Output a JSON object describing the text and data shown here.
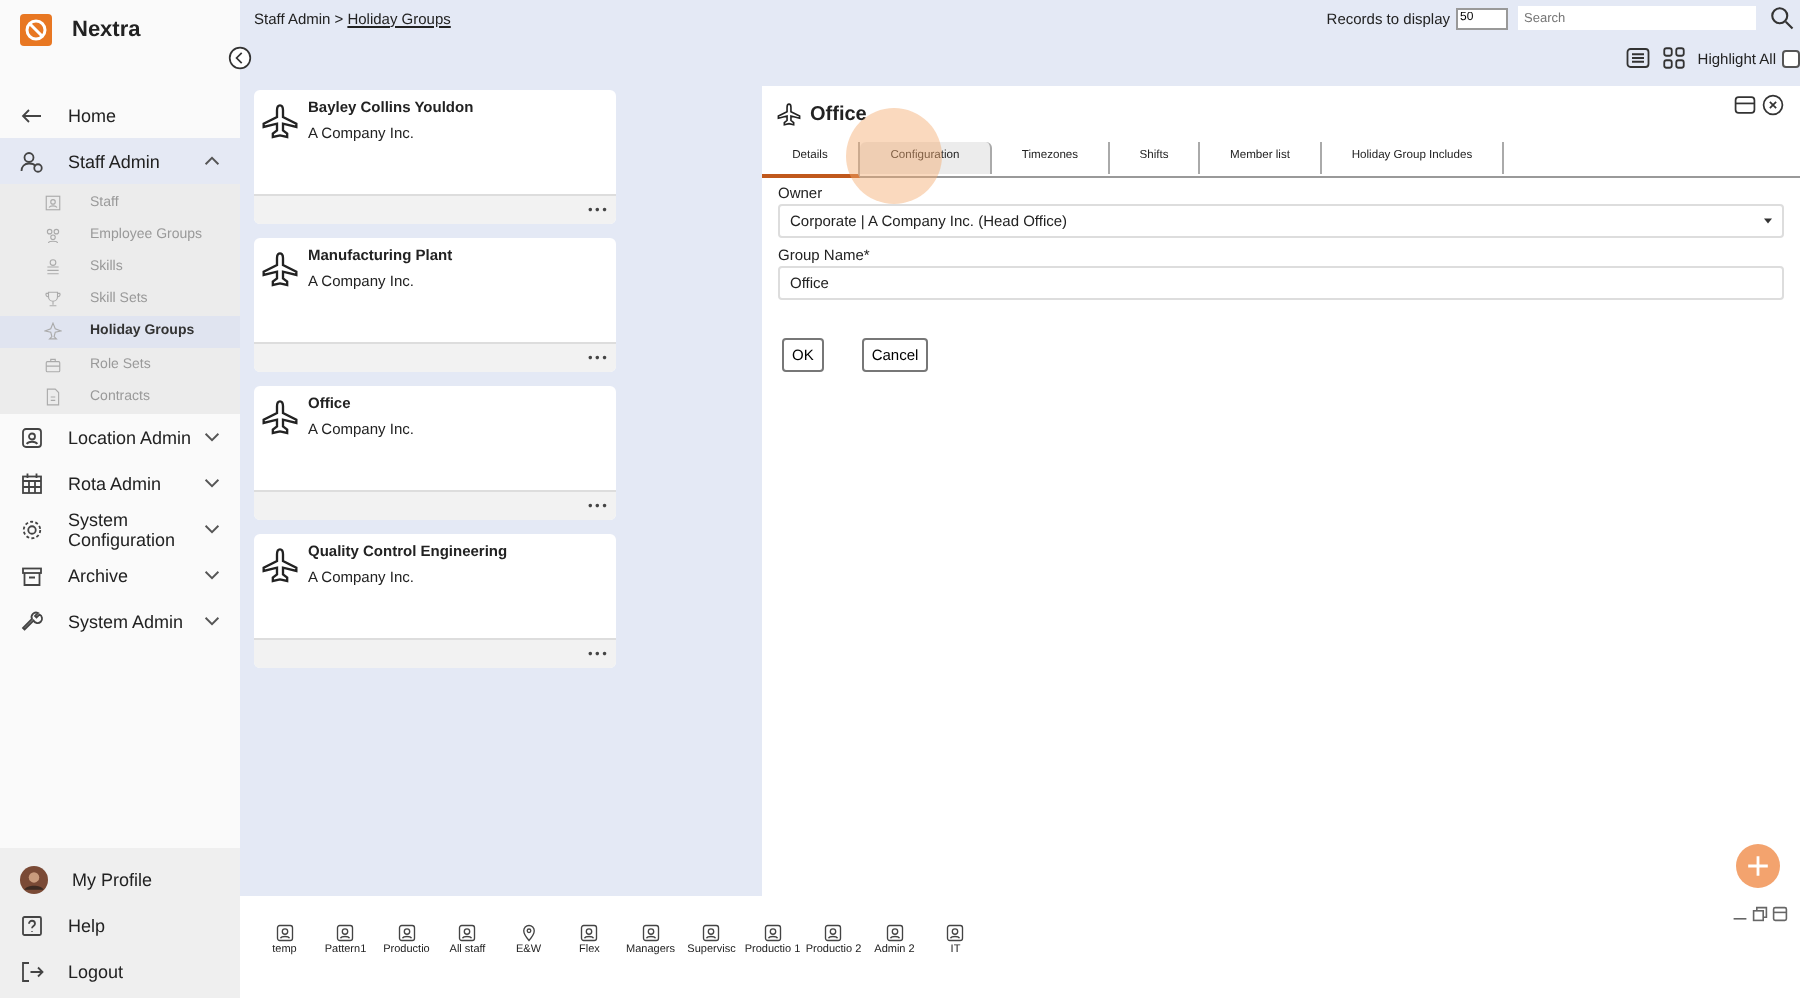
{
  "app": {
    "name": "Nextra"
  },
  "sidebar": {
    "items": [
      {
        "label": "Home"
      },
      {
        "label": "Staff Admin",
        "expanded": true,
        "children": [
          {
            "label": "Staff",
            "selected": false
          },
          {
            "label": "Employee Groups",
            "selected": false
          },
          {
            "label": "Skills",
            "selected": false
          },
          {
            "label": "Skill Sets",
            "selected": false
          },
          {
            "label": "Holiday Groups",
            "selected": true
          },
          {
            "label": "Role Sets",
            "selected": false
          },
          {
            "label": "Contracts",
            "selected": false
          }
        ]
      },
      {
        "label": "Location Admin",
        "expanded": false
      },
      {
        "label": "Rota Admin",
        "expanded": false
      },
      {
        "label": "System Configuration",
        "expanded": false
      },
      {
        "label": "Archive",
        "expanded": false
      },
      {
        "label": "System Admin",
        "expanded": false
      }
    ],
    "footer": [
      {
        "label": "My Profile"
      },
      {
        "label": "Help"
      },
      {
        "label": "Logout"
      }
    ]
  },
  "breadcrumb": {
    "parent": "Staff Admin >",
    "current": "Holiday Groups"
  },
  "records": {
    "label": "Records to display",
    "value": "50",
    "search_placeholder": "Search"
  },
  "view": {
    "highlight_label": "Highlight All",
    "highlight_checked": false
  },
  "cards": [
    {
      "title": "Bayley Collins Youldon",
      "subtitle": "A Company Inc.",
      "menu": "•••"
    },
    {
      "title": "Manufacturing Plant",
      "subtitle": "A Company Inc.",
      "menu": "•••"
    },
    {
      "title": "Office",
      "subtitle": "A Company Inc.",
      "menu": "•••"
    },
    {
      "title": "Quality Control Engineering",
      "subtitle": "A Company Inc.",
      "menu": "•••"
    }
  ],
  "detail": {
    "title": "Office",
    "tabs": [
      {
        "label": "Details",
        "selected": true,
        "hovered": false
      },
      {
        "label": "Configuration",
        "selected": false,
        "hovered": true
      },
      {
        "label": "Timezones",
        "selected": false,
        "hovered": false
      },
      {
        "label": "Shifts",
        "selected": false,
        "hovered": false
      },
      {
        "label": "Member list",
        "selected": false,
        "hovered": false
      },
      {
        "label": "Holiday Group Includes",
        "selected": false,
        "hovered": false
      }
    ],
    "owner_label": "Owner",
    "owner_value": "Corporate | A Company Inc. (Head Office)",
    "name_label": "Group Name*",
    "name_value": "Office",
    "buttons": [
      "OK",
      "Cancel"
    ]
  },
  "tray": [
    {
      "label": "temp",
      "kind": "person"
    },
    {
      "label": "Pattern1",
      "kind": "person"
    },
    {
      "label": "Productio",
      "kind": "person"
    },
    {
      "label": "All staff",
      "kind": "person"
    },
    {
      "label": "E&W",
      "kind": "pin"
    },
    {
      "label": "Flex",
      "kind": "person"
    },
    {
      "label": "Managers",
      "kind": "person"
    },
    {
      "label": "Supervisc",
      "kind": "person"
    },
    {
      "label": "Productio 1",
      "kind": "person"
    },
    {
      "label": "Productio 2",
      "kind": "person"
    },
    {
      "label": "Admin 2",
      "kind": "person"
    },
    {
      "label": "IT",
      "kind": "person"
    }
  ]
}
